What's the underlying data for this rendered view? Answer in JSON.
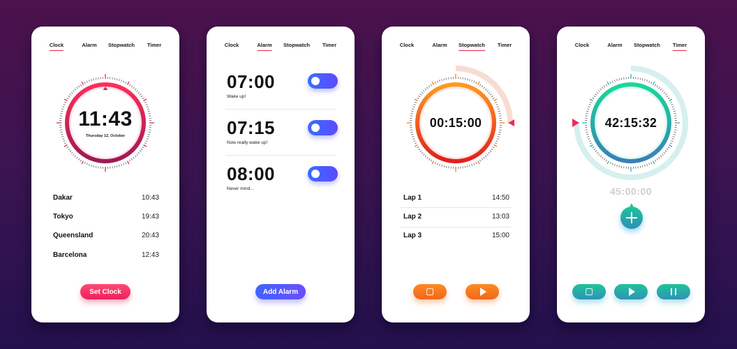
{
  "tabs": [
    "Clock",
    "Alarm",
    "Stopwatch",
    "Timer"
  ],
  "colors": {
    "clock_accent": "#e8254f",
    "alarm_accent": "#4a5cff",
    "stopwatch_accent": "#f57a1f",
    "timer_accent": "#22b8a4",
    "marker": "#ef2a5a"
  },
  "clock": {
    "active_tab": "Clock",
    "time": "11:43",
    "date": "Thursday 12, October",
    "cities": [
      {
        "name": "Dakar",
        "time": "10:43"
      },
      {
        "name": "Tokyo",
        "time": "19:43"
      },
      {
        "name": "Queensland",
        "time": "20:43"
      },
      {
        "name": "Barcelona",
        "time": "12:43"
      }
    ],
    "button": "Set Clock"
  },
  "alarm": {
    "active_tab": "Alarm",
    "alarms": [
      {
        "time": "07:00",
        "label": "Wake up!",
        "enabled": true
      },
      {
        "time": "07:15",
        "label": "Now really wake up!",
        "enabled": true
      },
      {
        "time": "08:00",
        "label": "Never mind...",
        "enabled": true
      }
    ],
    "button": "Add Alarm"
  },
  "stopwatch": {
    "active_tab": "Stopwatch",
    "time": "00:15:00",
    "progress_fraction": 0.25,
    "laps": [
      {
        "name": "Lap 1",
        "time": "14:50"
      },
      {
        "name": "Lap 2",
        "time": "13:03"
      },
      {
        "name": "Lap 3",
        "time": "15:00"
      }
    ],
    "controls": [
      "stop",
      "play"
    ]
  },
  "timer": {
    "active_tab": "Timer",
    "time": "42:15:32",
    "preset": "45:00:00",
    "progress_fraction": 0.75,
    "controls": [
      "stop",
      "play",
      "pause"
    ]
  }
}
